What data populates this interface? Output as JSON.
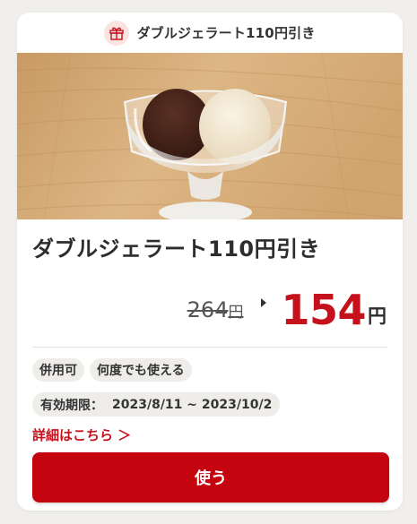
{
  "coupon": {
    "header_label": "ダブルジェラート110円引き",
    "header_icon": "gift-icon",
    "title": "ダブルジェラート110円引き",
    "image_alt_subject": "ice-cream-icon",
    "price": {
      "original": "264",
      "original_unit": "円",
      "discounted": "154",
      "discounted_unit": "円"
    },
    "tags": [
      "併用可",
      "何度でも使える"
    ],
    "validity": {
      "label": "有効期限：",
      "range": "2023/8/11 ~ 2023/10/2"
    },
    "details_link": "詳細はこちら ＞",
    "use_button": "使う"
  },
  "colors": {
    "accent": "#c4111b",
    "button": "#c4050f",
    "background": "#f1efec",
    "tag_bg": "#efedea"
  }
}
